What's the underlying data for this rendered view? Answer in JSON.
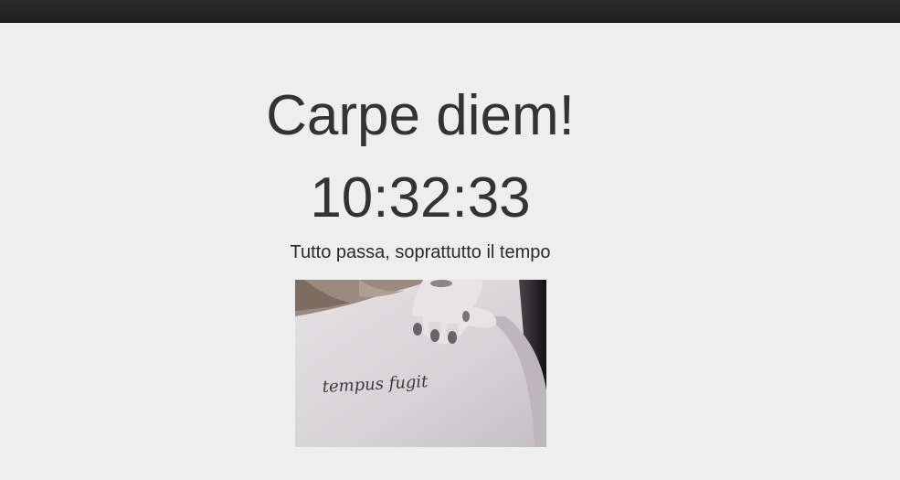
{
  "page": {
    "title": "Carpe diem!",
    "clock": "10:32:33",
    "subtitle": "Tutto passa, soprattutto il tempo"
  },
  "image": {
    "subject": "tattoo-photo",
    "tattoo_text": "tempus fugit"
  },
  "colors": {
    "background": "#eeeeee",
    "topbar": "#222222",
    "text": "#333333"
  }
}
